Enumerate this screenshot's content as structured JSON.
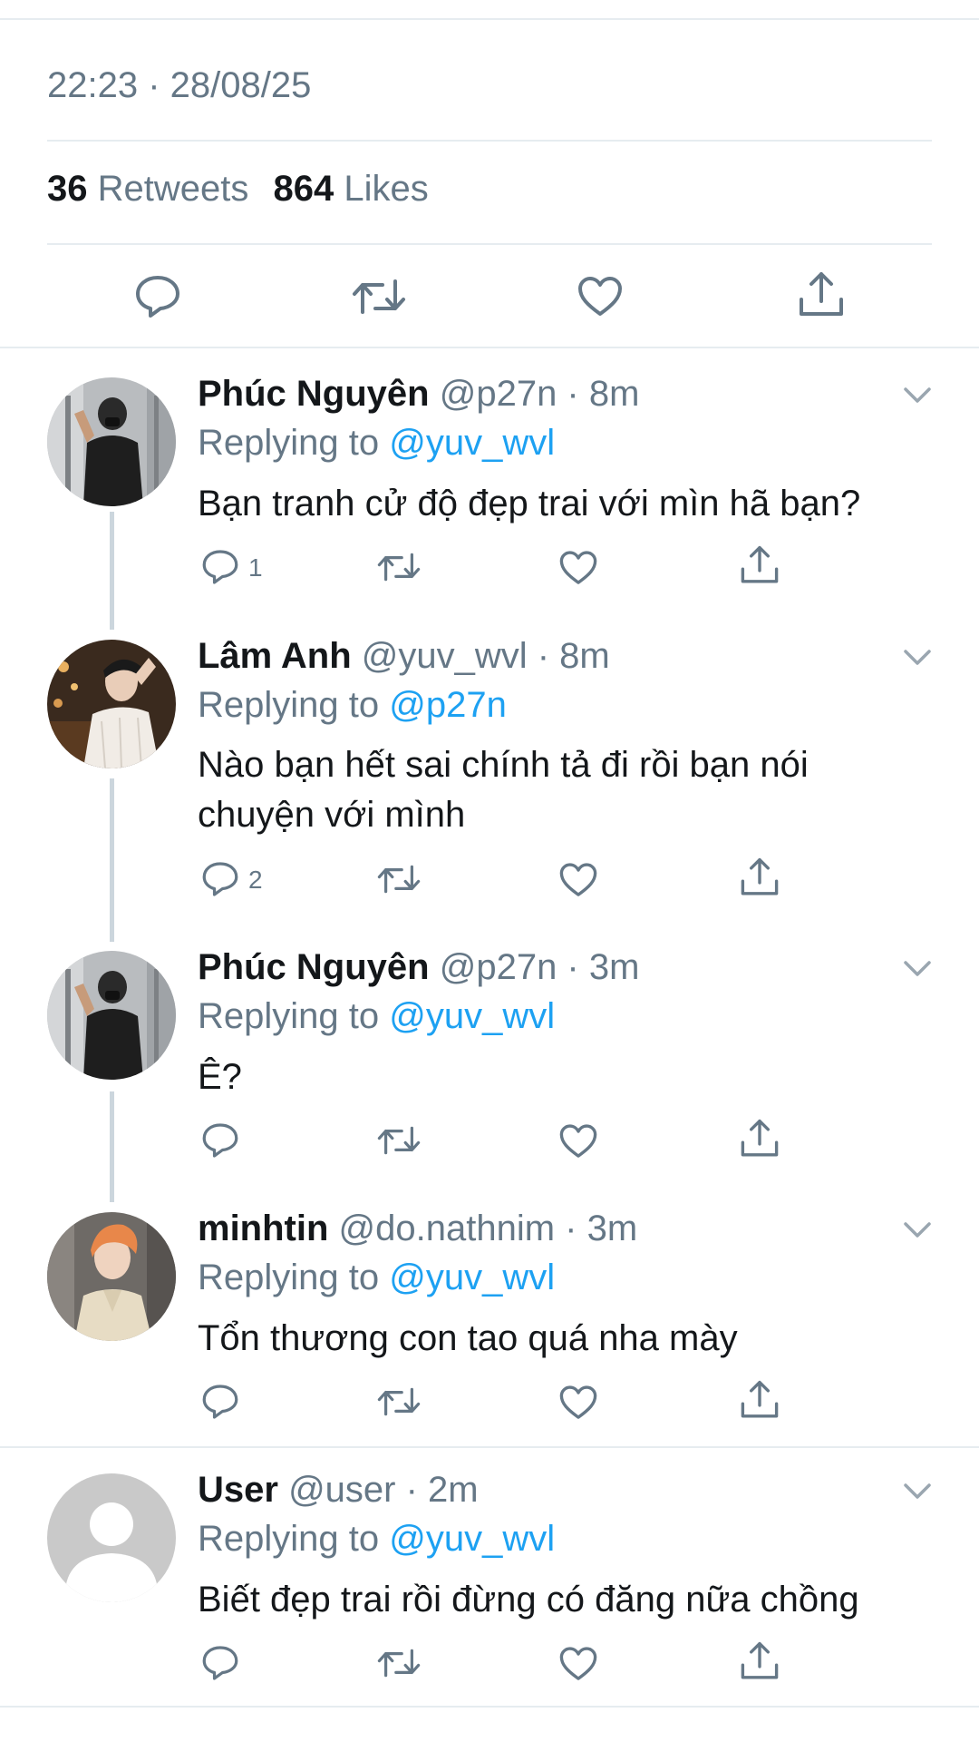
{
  "tweet": {
    "timestamp": "22:23 · 28/08/25",
    "retweets_count": "36",
    "retweets_label": "Retweets",
    "likes_count": "864",
    "likes_label": "Likes"
  },
  "icons": {
    "reply": "reply-icon",
    "retweet": "retweet-icon",
    "like": "heart-icon",
    "share": "share-icon",
    "more": "chevron-down-icon"
  },
  "colors": {
    "text": "#14171a",
    "secondary": "#657786",
    "link": "#1da1f2",
    "divider": "#e6ecf0",
    "thread_line": "#ccd6dd"
  },
  "replies": [
    {
      "name": "Phúc Nguyên",
      "handle": "@p27n · 8m",
      "replying_label": "Replying to",
      "replying_to": "@yuv_wvl",
      "text": "Bạn tranh cử độ đẹp trai với mìn hã bạn?",
      "reply_count": "1"
    },
    {
      "name": "Lâm Anh",
      "handle": "@yuv_wvl · 8m",
      "replying_label": "Replying to",
      "replying_to": "@p27n",
      "text": "Nào bạn hết sai chính tả đi rồi bạn nói chuyện với mình",
      "reply_count": "2"
    },
    {
      "name": "Phúc Nguyên",
      "handle": "@p27n · 3m",
      "replying_label": "Replying to",
      "replying_to": "@yuv_wvl",
      "text": "Ê?",
      "reply_count": ""
    },
    {
      "name": "minhtin",
      "handle": "@do.nathnim · 3m",
      "replying_label": "Replying to",
      "replying_to": "@yuv_wvl",
      "text": "Tổn thương con tao quá nha mày",
      "reply_count": ""
    },
    {
      "name": "User",
      "handle": "@user · 2m",
      "replying_label": "Replying to",
      "replying_to": "@yuv_wvl",
      "text": "Biết đẹp trai rồi đừng có đăng nữa chồng",
      "reply_count": ""
    }
  ]
}
